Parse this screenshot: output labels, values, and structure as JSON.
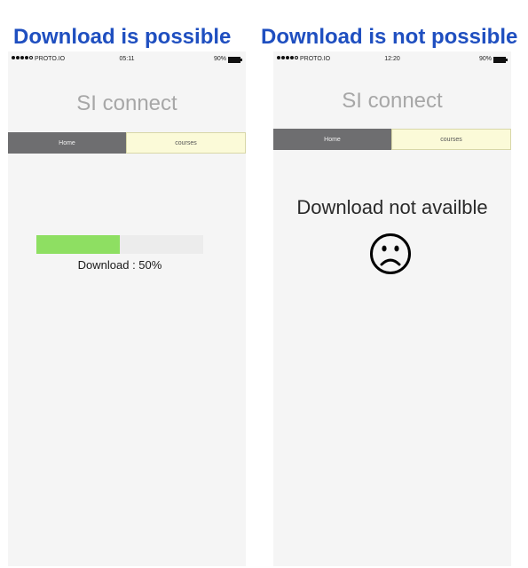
{
  "headings": {
    "left": "Download is possible",
    "right": "Download is not possible"
  },
  "phone_left": {
    "status_bar": {
      "carrier": "PROTO.IO",
      "time": "05:11",
      "battery": "90%"
    },
    "app_title": "SI connect",
    "tabs": [
      {
        "label": "Home",
        "active": true
      },
      {
        "label": "courses",
        "active": false
      }
    ],
    "download": {
      "label": "Download : 50%",
      "progress": 0.5
    }
  },
  "phone_right": {
    "status_bar": {
      "carrier": "PROTO.IO",
      "time": "12:20",
      "battery": "90%"
    },
    "app_title": "SI connect",
    "tabs": [
      {
        "label": "Home",
        "active": true
      },
      {
        "label": "courses",
        "active": false
      }
    ],
    "message": "Download not availble",
    "icon": "sad-face-icon"
  },
  "colors": {
    "heading": "#1f4fc0",
    "progress_fill": "#8edf62",
    "tab_active": "#6e6e70",
    "tab_inactive": "#fbfad8"
  }
}
